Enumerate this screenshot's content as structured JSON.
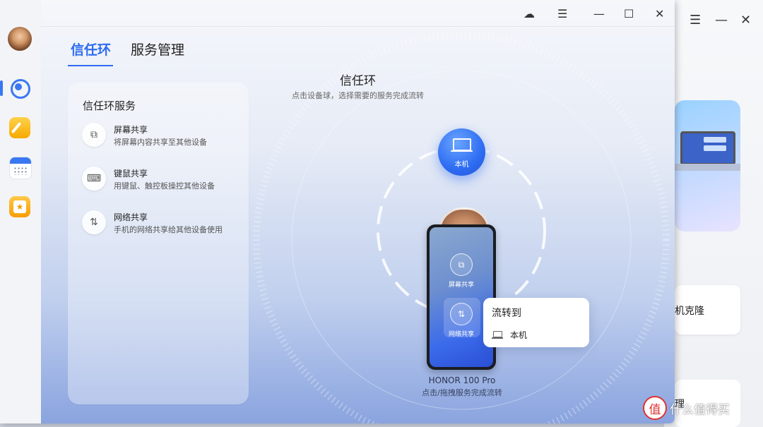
{
  "background_app": {
    "menu_icon": "menu-icon",
    "minimize_icon": "minimize-icon",
    "close_icon": "close-icon",
    "card2_text": "机克隆",
    "card3_text": "理"
  },
  "watermark": {
    "logo": "值",
    "text": "什么值得买"
  },
  "sidebar": {
    "items": [
      {
        "name": "trust-ring",
        "icon": "trust-ring-icon",
        "active": true
      },
      {
        "name": "notes",
        "icon": "notes-icon"
      },
      {
        "name": "calendar",
        "icon": "calendar-icon"
      },
      {
        "name": "gallery",
        "icon": "gallery-icon"
      }
    ]
  },
  "titlebar": {
    "cloud": "cloud-icon",
    "menu": "menu-icon",
    "minimize": "minimize-icon",
    "maximize": "maximize-icon",
    "close": "close-icon"
  },
  "tabs": [
    {
      "label": "信任环",
      "active": true
    },
    {
      "label": "服务管理",
      "active": false
    }
  ],
  "services_panel": {
    "title": "信任环服务",
    "items": [
      {
        "name": "屏幕共享",
        "desc": "将屏幕内容共享至其他设备",
        "icon": "screen-share-icon"
      },
      {
        "name": "键鼠共享",
        "desc": "用键鼠、触控板操控其他设备",
        "icon": "keyboard-mouse-share-icon"
      },
      {
        "name": "网络共享",
        "desc": "手机的网络共享给其他设备使用",
        "icon": "network-share-icon"
      }
    ]
  },
  "center": {
    "title": "信任环",
    "subtitle": "点击设备球，选择需要的服务完成流转",
    "local_device_label": "本机",
    "phone": {
      "services": [
        {
          "label": "屏幕共享",
          "icon": "screen-share-icon"
        },
        {
          "label": "网络共享",
          "icon": "network-share-icon"
        }
      ],
      "name": "HONOR 100 Pro",
      "hint": "点击/拖拽服务完成流转"
    }
  },
  "flow_popup": {
    "title": "流转到",
    "item": "本机",
    "item_icon": "laptop-icon"
  },
  "colors": {
    "accent": "#2d6cf0"
  }
}
